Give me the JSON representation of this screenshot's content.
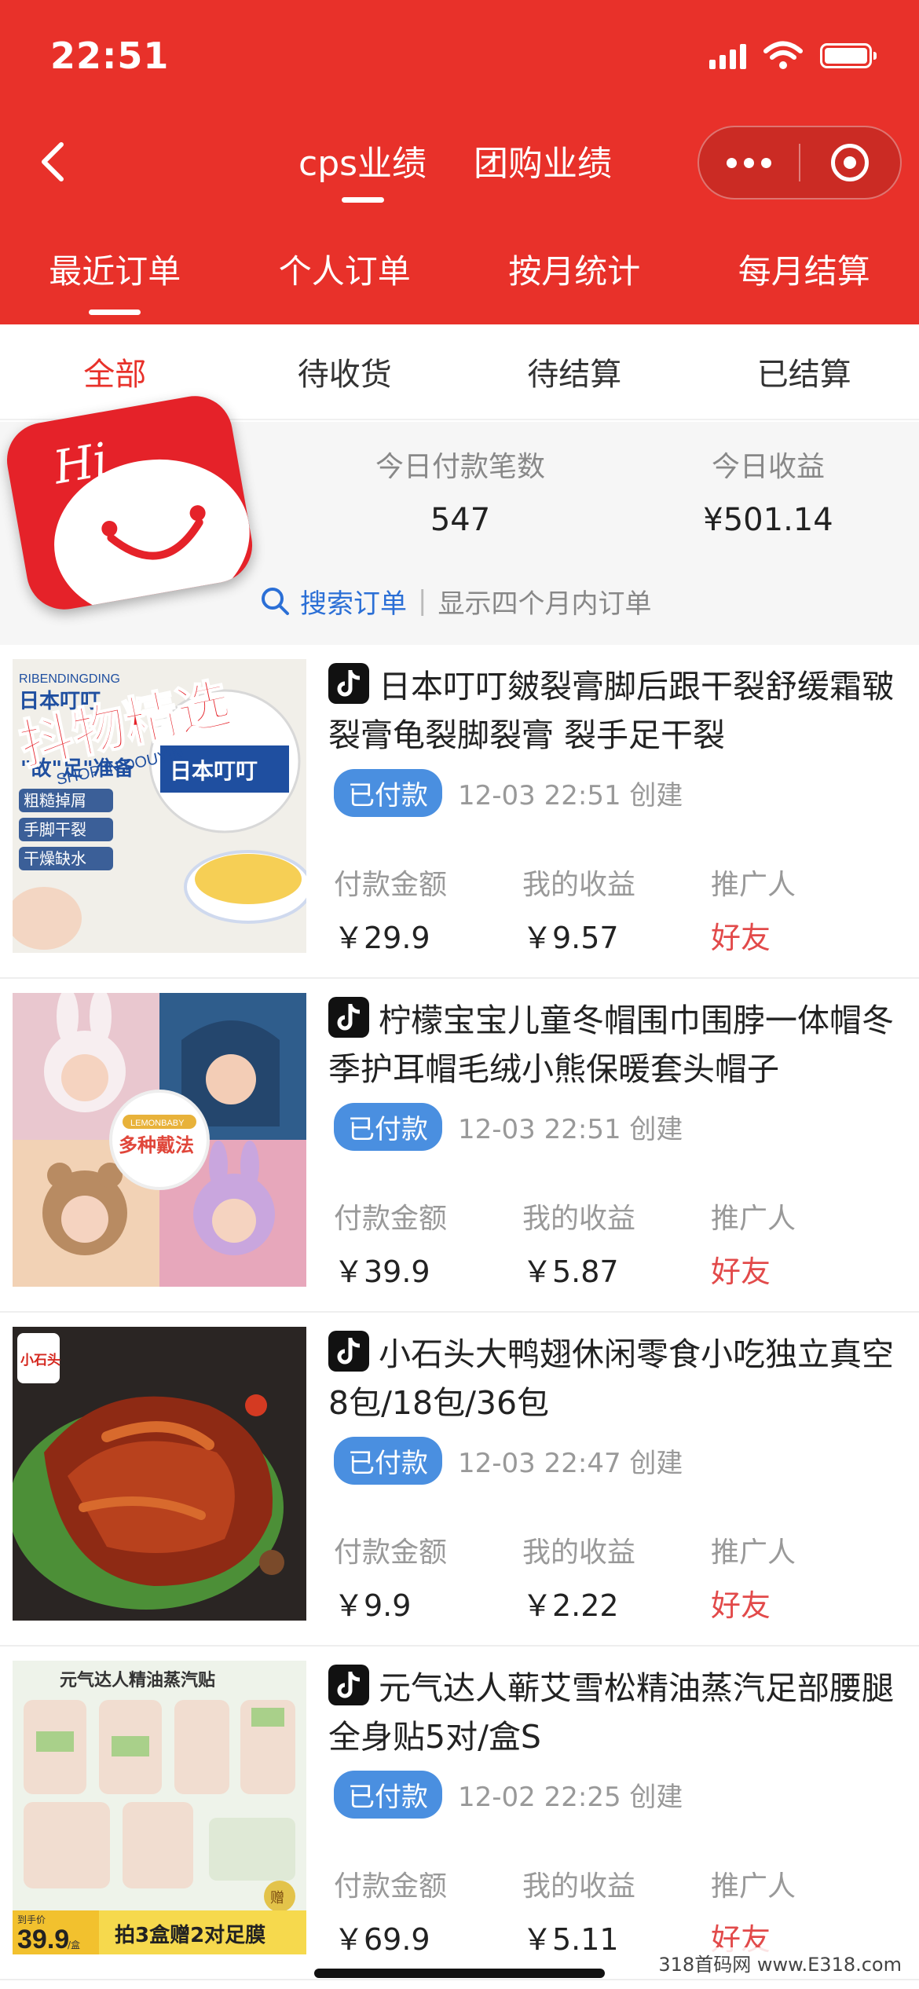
{
  "status_bar": {
    "time": "22:51",
    "signal_icon": "signal-icon",
    "wifi_icon": "wifi-icon",
    "battery_icon": "battery-icon"
  },
  "header": {
    "back_icon": "chevron-left-icon",
    "top_tabs": [
      {
        "label": "cps业绩",
        "active": true
      },
      {
        "label": "团购业绩",
        "active": false
      }
    ],
    "capsule": {
      "more_icon": "more-dots-icon",
      "close_icon": "target-close-icon"
    },
    "sub_tabs": [
      {
        "label": "最近订单",
        "active": true
      },
      {
        "label": "个人订单",
        "active": false
      },
      {
        "label": "按月统计",
        "active": false
      },
      {
        "label": "每月结算",
        "active": false
      }
    ]
  },
  "filter_tabs": [
    {
      "label": "全部",
      "active": true
    },
    {
      "label": "待收货",
      "active": false
    },
    {
      "label": "待结算",
      "active": false
    },
    {
      "label": "已结算",
      "active": false
    }
  ],
  "stats": {
    "count_label": "今日付款笔数",
    "count_value": "547",
    "income_label": "今日收益",
    "income_value": "¥501.14"
  },
  "search": {
    "link": "搜索订单",
    "separator": "|",
    "note": "显示四个月内订单"
  },
  "overlays": {
    "hi_badge_text": "Hi",
    "sticker_text": "抖物精选",
    "sticker_sub": "SHOP IN DOUYIN"
  },
  "meta_labels": {
    "amount": "付款金额",
    "income": "我的收益",
    "promoter": "推广人"
  },
  "orders": [
    {
      "title": "日本叮叮皴裂膏脚后跟干裂舒缓霜皲裂膏龟裂脚裂膏 裂手足干裂",
      "status": "已付款",
      "time": "12-03 22:51 创建",
      "amount": "￥29.9",
      "income": "￥9.57",
      "promoter": "好友",
      "image_text": {
        "brand": "RIBENDINGDING",
        "name": "日本叮叮",
        "tag1": "粗糙掉屑",
        "tag2": "手脚干裂",
        "tag3": "干燥缺水",
        "slogan": "\"故\"足\"准备"
      }
    },
    {
      "title": "柠檬宝宝儿童冬帽围巾围脖一体帽冬季护耳帽毛绒小熊保暖套头帽子",
      "status": "已付款",
      "time": "12-03 22:51 创建",
      "amount": "￥39.9",
      "income": "￥5.87",
      "promoter": "好友",
      "image_text": {
        "badge": "多种戴法",
        "small": "LEMONBABY"
      }
    },
    {
      "title": "小石头大鸭翅休闲零食小吃独立真空8包/18包/36包",
      "status": "已付款",
      "time": "12-03 22:47 创建",
      "amount": "￥9.9",
      "income": "￥2.22",
      "promoter": "好友",
      "image_text": {
        "logo": "小石头"
      }
    },
    {
      "title": "元气达人蕲艾雪松精油蒸汽足部腰腿全身贴5对/盒S",
      "status": "已付款",
      "time": "12-02 22:25 创建",
      "amount": "￥69.9",
      "income": "￥5.11",
      "promoter": "好友",
      "image_text": {
        "banner": "元气达人精油蒸汽贴",
        "price_tag": "到手价",
        "price": "39.9",
        "price_unit": "/盒",
        "promo": "拍3盒赠2对足膜",
        "gift": "赠"
      }
    }
  ],
  "footer": {
    "site_watermark": "318首码网 www.E318.com"
  }
}
